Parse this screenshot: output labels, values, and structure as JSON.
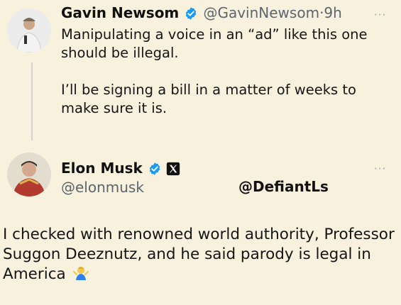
{
  "reply_tweet": {
    "author_name": "Gavin Newsom",
    "author_handle": "@GavinNewsom",
    "separator": "·",
    "time": "9h",
    "more_label": "···",
    "paragraph_1": "Manipulating a voice in an “ad” like this one should be illegal.",
    "paragraph_2": "I’ll be signing a bill in a matter of weeks to make sure it is."
  },
  "main_tweet": {
    "author_name": "Elon Musk",
    "author_handle": "@elonmusk",
    "more_label": "···",
    "text": "I checked with renowned world authority, Professor Suggon Deeznutz, and he said parody is legal in America"
  },
  "watermark": "@DefiantLs",
  "colors": {
    "background": "#f7f1dd",
    "verified_blue": "#1d9bf0",
    "handle_gray": "#5c6670"
  },
  "icons": {
    "verified": "verified-badge-icon",
    "affiliate": "x-logo-icon",
    "emoji": "person-shrugging-emoji"
  }
}
